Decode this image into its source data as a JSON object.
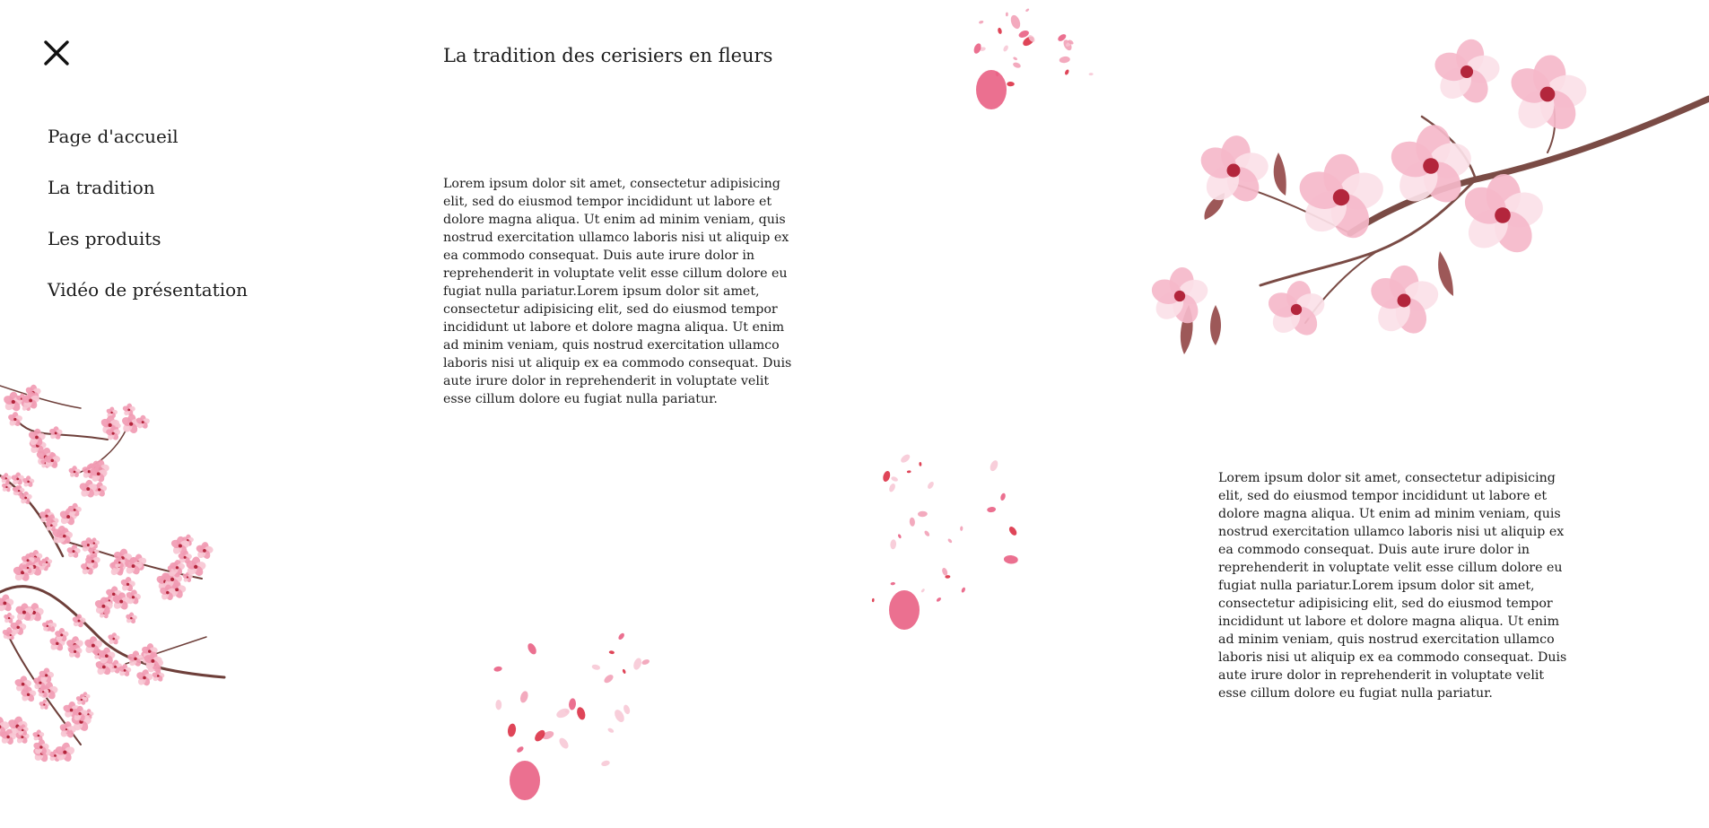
{
  "menu": {
    "close_label": "✕",
    "close_icon": "close-icon",
    "items": [
      {
        "label": "Page d'accueil"
      },
      {
        "label": "La tradition"
      },
      {
        "label": "Les produits"
      },
      {
        "label": "Vidéo de présentation"
      }
    ]
  },
  "main": {
    "title": "La tradition des cerisiers en fleurs",
    "paragraph_1": "Lorem ipsum dolor sit amet, consectetur adipisicing elit, sed do eiusmod tempor incididunt ut labore et dolore magna aliqua. Ut enim ad minim veniam, quis nostrud exercitation ullamco laboris nisi ut aliquip ex ea commodo consequat. Duis aute irure dolor in reprehenderit in voluptate velit esse cillum dolore eu fugiat nulla pariatur.Lorem ipsum dolor sit amet, consectetur adipisicing elit, sed do eiusmod tempor incididunt ut labore et dolore magna aliqua. Ut enim ad minim veniam, quis nostrud exercitation ullamco laboris nisi ut aliquip ex ea commodo consequat. Duis aute irure dolor in reprehenderit in voluptate velit esse cillum dolore eu fugiat nulla pariatur.",
    "paragraph_2": "Lorem ipsum dolor sit amet, consectetur adipisicing elit, sed do eiusmod tempor incididunt ut labore et dolore magna aliqua. Ut enim ad minim veniam, quis nostrud exercitation ullamco laboris nisi ut aliquip ex ea commodo consequat. Duis aute irure dolor in reprehenderit in voluptate velit esse cillum dolore eu fugiat nulla pariatur.Lorem ipsum dolor sit amet, consectetur adipisicing elit, sed do eiusmod tempor incididunt ut labore et dolore magna aliqua. Ut enim ad minim veniam, quis nostrud exercitation ullamco laboris nisi ut aliquip ex ea commodo consequat. Duis aute irure dolor in reprehenderit in voluptate velit esse cillum dolore eu fugiat nulla pariatur."
  },
  "decorations": {
    "colors": {
      "petal_light": "#f7c6d3",
      "petal_mid": "#f19bb3",
      "petal_deep": "#e8577c",
      "petal_red": "#d9243b",
      "branch": "#7a4b45",
      "center": "#b3263c"
    },
    "images": [
      "cherry-blossom-tree-illustration",
      "cherry-blossom-branch-illustration",
      "falling-petals-illustration"
    ]
  }
}
